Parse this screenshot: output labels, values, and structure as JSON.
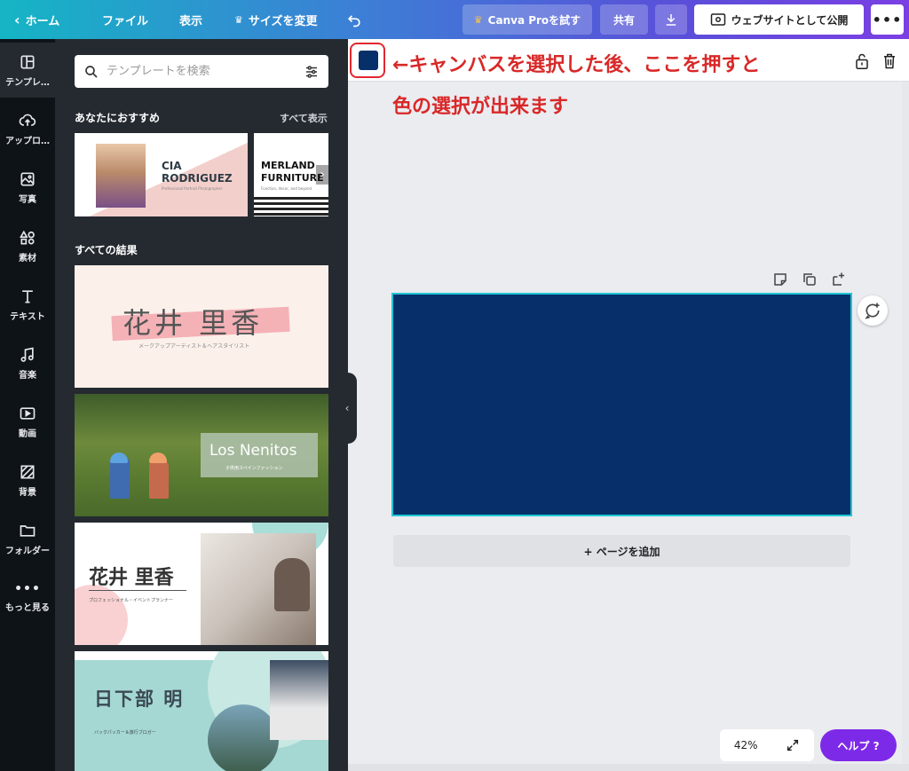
{
  "topbar": {
    "home_label": "ホーム",
    "file_label": "ファイル",
    "view_label": "表示",
    "resize_label": "サイズを変更",
    "try_pro_label": "Canva Proを試す",
    "share_label": "共有",
    "publish_label": "ウェブサイトとして公開"
  },
  "rail": {
    "items": [
      {
        "label": "テンプレ…"
      },
      {
        "label": "アップロ…"
      },
      {
        "label": "写真"
      },
      {
        "label": "素材"
      },
      {
        "label": "テキスト"
      },
      {
        "label": "音楽"
      },
      {
        "label": "動画"
      },
      {
        "label": "背景"
      },
      {
        "label": "フォルダー"
      },
      {
        "label": "もっと見る"
      }
    ]
  },
  "panel": {
    "search_placeholder": "テンプレートを検索",
    "recommended_title": "あなたにおすすめ",
    "see_all_label": "すべて表示",
    "all_results_title": "すべての結果",
    "rec1": {
      "name": "CIA\nRODRIGUEZ",
      "sub": "Professional Portrait Photographer"
    },
    "rec2": {
      "name": "MERLAND\nFURNITURE",
      "sub": "Function, decor, and beyond"
    },
    "t1": {
      "name": "花井 里香",
      "sub": "メークアップアーティスト＆ヘアスタイリスト"
    },
    "t2": {
      "name": "Los Nenitos",
      "sub": "子供用スペインファッション"
    },
    "t3": {
      "name": "花井 里香",
      "sub": "プロフェッショナル・イベントプランナー"
    },
    "t4": {
      "name": "日下部 明",
      "sub": "バックパッカー＆旅行ブロガー"
    }
  },
  "canvas": {
    "annotation_line1": "←キャンバスを選択した後、ここを押すと",
    "annotation_line2": "色の選択が出来ます",
    "add_page_label": "+ ページを追加",
    "zoom_label": "42%",
    "help_label": "ヘルプ ?",
    "background_color": "#07306a",
    "selection_color": "#1fc6d6"
  }
}
